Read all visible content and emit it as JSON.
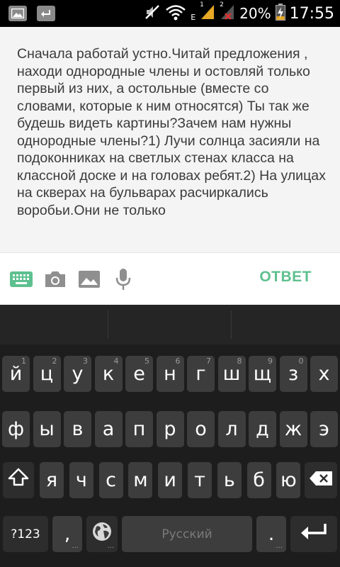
{
  "status_bar": {
    "battery": "20%",
    "time": "17:55",
    "network_type": "E",
    "sim1": "1",
    "sim2": "2",
    "icons": [
      "gallery-icon",
      "usb-icon",
      "mute-icon",
      "wifi-icon",
      "signal-icon",
      "battery-icon"
    ]
  },
  "question": {
    "text": "Сначала работай устно.Читай предложения , находи однородные члены и остовляй только первый из них, а остольные (вместе со словами, которые к ним относятся) Ты так же будешь видеть картины?Зачем нам нужны однородные члены?1) Лучи солнца засияли на подоконниках на светлых стенах класса на классной доске и на головах ребят.2) На улицах на скверах на бульварах расчиркались воробьи.Они не только"
  },
  "toolbar": {
    "icons": [
      "keyboard-icon",
      "camera-icon",
      "image-icon",
      "microphone-icon"
    ],
    "answer_label": "ОТВЕТ",
    "answer_color": "#5ec08f"
  },
  "keyboard": {
    "row1": [
      {
        "label": "й",
        "hint": "1"
      },
      {
        "label": "ц",
        "hint": "2"
      },
      {
        "label": "у",
        "hint": "3"
      },
      {
        "label": "к",
        "hint": "4"
      },
      {
        "label": "е",
        "hint": "5"
      },
      {
        "label": "н",
        "hint": "6"
      },
      {
        "label": "г",
        "hint": "7"
      },
      {
        "label": "ш",
        "hint": "8"
      },
      {
        "label": "щ",
        "hint": "9"
      },
      {
        "label": "з",
        "hint": "0"
      },
      {
        "label": "х",
        "hint": ""
      }
    ],
    "row2": [
      "ф",
      "ы",
      "в",
      "а",
      "п",
      "р",
      "о",
      "л",
      "д",
      "ж",
      "э"
    ],
    "row3": [
      "я",
      "ч",
      "с",
      "м",
      "и",
      "т",
      "ь",
      "б",
      "ю"
    ],
    "symbols_label": "?123",
    "comma_label": ",",
    "space_label": "Русский",
    "period_label": ".",
    "dots": "...",
    "icons": [
      "shift-icon",
      "backspace-icon",
      "globe-icon",
      "enter-icon"
    ]
  }
}
